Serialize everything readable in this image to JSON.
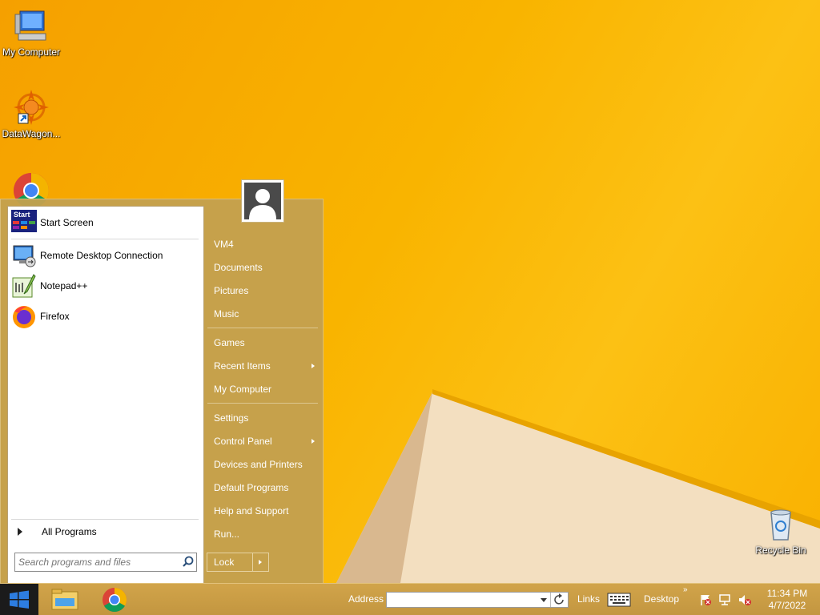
{
  "desktop": {
    "icons": [
      {
        "label": "My Computer"
      },
      {
        "label": "DataWagon..."
      },
      {
        "label": ""
      },
      {
        "label": "Recycle Bin"
      }
    ]
  },
  "start_menu": {
    "pinned": [
      {
        "label": "Start Screen",
        "icon": "start-screen-icon"
      },
      {
        "label": "Remote Desktop Connection",
        "icon": "remote-desktop-icon"
      },
      {
        "label": "Notepad++",
        "icon": "notepadpp-icon"
      },
      {
        "label": "Firefox",
        "icon": "firefox-icon"
      }
    ],
    "start_tile_text": "Start",
    "all_programs": "All Programs",
    "search_placeholder": "Search programs and files",
    "right_links": [
      {
        "label": "VM4",
        "submenu": false
      },
      {
        "label": "Documents",
        "submenu": false
      },
      {
        "label": "Pictures",
        "submenu": false
      },
      {
        "label": "Music",
        "submenu": false
      },
      {
        "label": "Games",
        "submenu": false
      },
      {
        "label": "Recent Items",
        "submenu": true
      },
      {
        "label": "My Computer",
        "submenu": false
      },
      {
        "label": "Settings",
        "submenu": false
      },
      {
        "label": "Control Panel",
        "submenu": true
      },
      {
        "label": "Devices and Printers",
        "submenu": false
      },
      {
        "label": "Default Programs",
        "submenu": false
      },
      {
        "label": "Help and Support",
        "submenu": false
      },
      {
        "label": "Run...",
        "submenu": false
      }
    ],
    "lock_label": "Lock"
  },
  "taskbar": {
    "address_label": "Address",
    "address_value": "",
    "links_label": "Links",
    "desktop_label": "Desktop",
    "chevron": "»",
    "time": "11:34 PM",
    "date": "4/7/2022"
  },
  "colors": {
    "accent": "#c4a04e",
    "wallpaper": "#f9b400",
    "start_button": "#1b1b1b"
  }
}
